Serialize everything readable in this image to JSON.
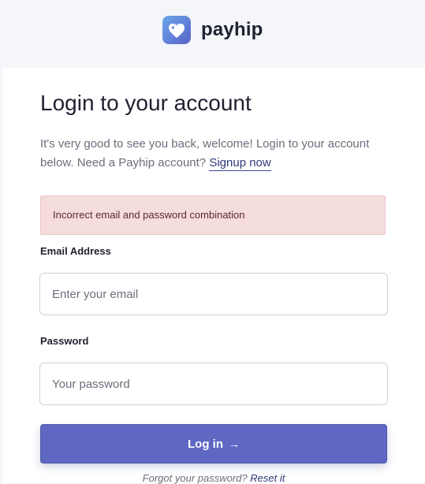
{
  "brand": {
    "name": "payhip",
    "icon": "heart-tag-logo-icon",
    "accent_color": "#5e68c3"
  },
  "login": {
    "title": "Login to your account",
    "subtitle_text": "It's very good to see you back, welcome! Login to your account below. Need a Payhip account?",
    "signup_link": "Signup now",
    "error_message": "Incorrect email and password combination",
    "email_label": "Email Address",
    "email_placeholder": "Enter your email",
    "email_value": "",
    "password_label": "Password",
    "password_placeholder": "Your password",
    "password_value": "",
    "submit_label": "Log in",
    "submit_icon": "arrow-right-icon",
    "submit_arrow": "→",
    "forgot_text": "Forgot your password?",
    "reset_link": "Reset it"
  }
}
